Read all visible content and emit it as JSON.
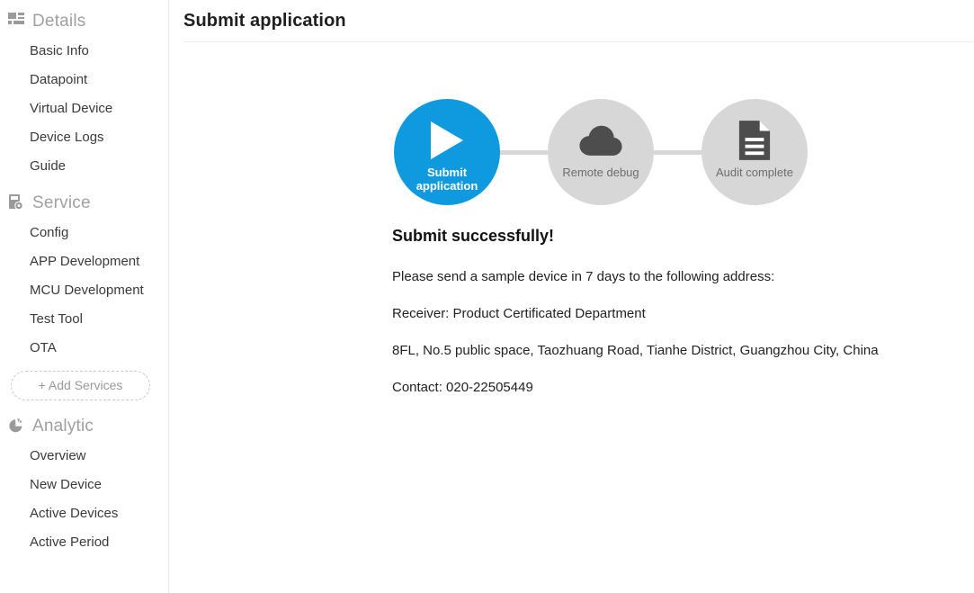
{
  "sidebar": {
    "sections": [
      {
        "id": "details",
        "title": "Details",
        "icon": "grid-dashboard-icon",
        "items": [
          {
            "label": "Basic Info"
          },
          {
            "label": "Datapoint"
          },
          {
            "label": "Virtual Device"
          },
          {
            "label": "Device Logs"
          },
          {
            "label": "Guide"
          }
        ]
      },
      {
        "id": "service",
        "title": "Service",
        "icon": "device-gear-icon",
        "items": [
          {
            "label": "Config"
          },
          {
            "label": "APP Development"
          },
          {
            "label": "MCU Development"
          },
          {
            "label": "Test Tool"
          },
          {
            "label": "OTA"
          }
        ],
        "add_button": "+ Add Services"
      },
      {
        "id": "analytic",
        "title": "Analytic",
        "icon": "pie-chart-icon",
        "items": [
          {
            "label": "Overview"
          },
          {
            "label": "New Device"
          },
          {
            "label": "Active Devices"
          },
          {
            "label": "Active Period"
          }
        ]
      }
    ]
  },
  "main": {
    "page_title": "Submit application",
    "stepper": {
      "steps": [
        {
          "label": "Submit\napplication",
          "label_line1": "Submit",
          "label_line2": "application",
          "icon": "play-triangle-icon",
          "state": "active"
        },
        {
          "label": "Remote debug",
          "label_line1": "Remote debug",
          "label_line2": "",
          "icon": "cloud-icon",
          "state": "inactive"
        },
        {
          "label": "Audit complete",
          "label_line1": "Audit complete",
          "label_line2": "",
          "icon": "document-icon",
          "state": "inactive"
        }
      ]
    },
    "message": {
      "heading": "Submit successfully!",
      "line_instruction": "Please send a sample device in 7 days to the following address:",
      "line_receiver": "Receiver: Product Certificated Department",
      "line_address": "8FL, No.5 public space, Taozhuang Road, Tianhe District, Guangzhou City, China",
      "line_contact": "Contact: 020-22505449"
    }
  },
  "colors": {
    "accent_blue": "#0f9ae0",
    "step_inactive_gray": "#d7d7d7",
    "icon_dark_gray": "#4d4d4d",
    "sidebar_heading_gray": "#a0a0a0",
    "divider_gray": "#ededed"
  }
}
